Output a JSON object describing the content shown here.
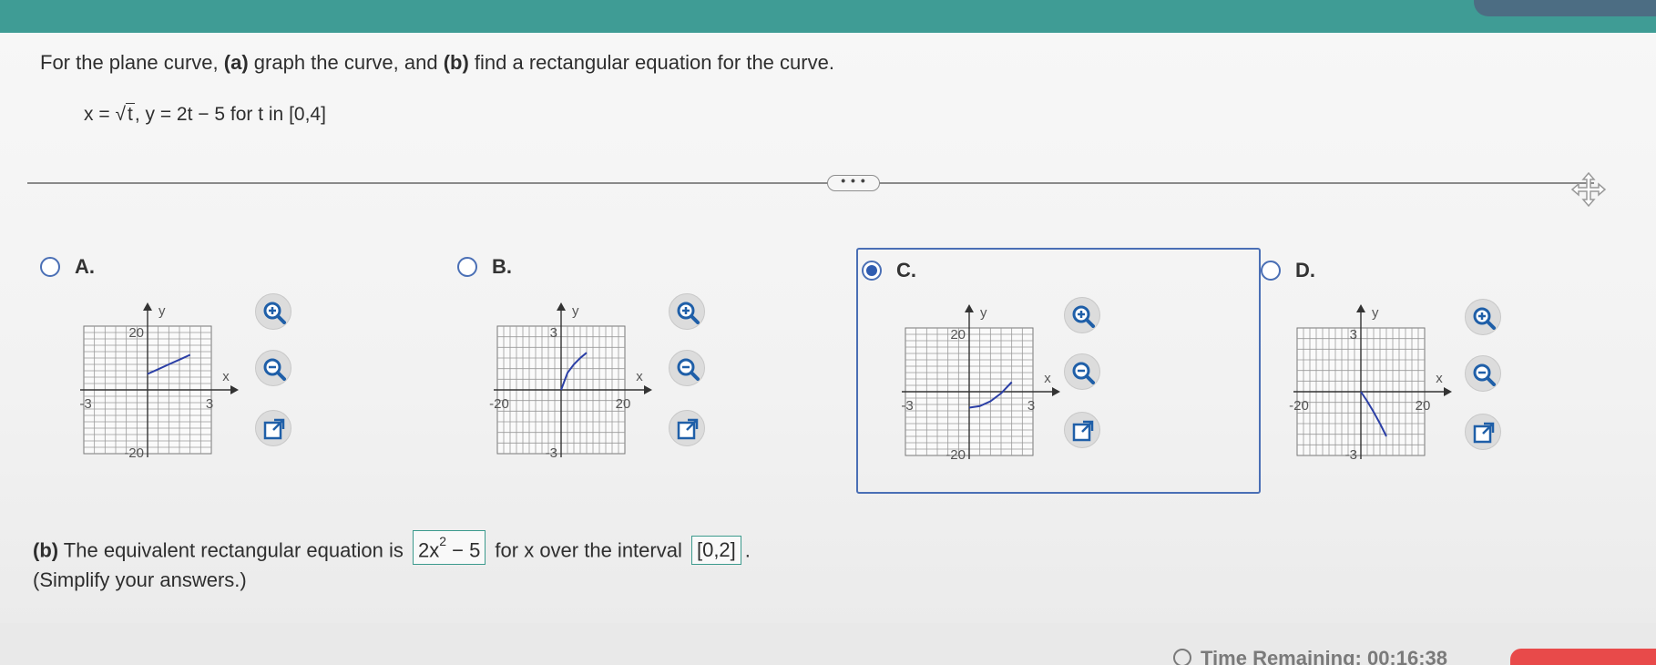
{
  "question": {
    "prompt_pre": "For the plane curve, ",
    "part_a_tag": "(a)",
    "prompt_mid1": " graph the curve, and ",
    "part_b_tag": "(b)",
    "prompt_mid2": " find a rectangular equation for the curve.",
    "eq_x_prefix": "x = ",
    "eq_radicand": "t",
    "eq_rest": ", y = 2t − 5 for t in [0,4]"
  },
  "more_button_label": "• • •",
  "options": [
    {
      "id": "A",
      "label": "A.",
      "selected": false,
      "graph": {
        "y_top": "20",
        "y_bottom": "-20",
        "x_left": "-3",
        "x_right": "3",
        "x_axis_label": "x",
        "y_axis_label": "y",
        "xlim": [
          -3,
          3
        ],
        "ylim": [
          -20,
          20
        ],
        "curve": [
          [
            0,
            5
          ],
          [
            0.5,
            6.5
          ],
          [
            1,
            8
          ],
          [
            1.5,
            9.5
          ],
          [
            2,
            11
          ]
        ]
      }
    },
    {
      "id": "B",
      "label": "B.",
      "selected": false,
      "graph": {
        "y_top": "3",
        "y_bottom": "-3",
        "x_left": "-20",
        "x_right": "20",
        "x_axis_label": "x",
        "y_axis_label": "y",
        "xlim": [
          -20,
          20
        ],
        "ylim": [
          -3,
          3
        ],
        "curve": [
          [
            0,
            0
          ],
          [
            2,
            0.8
          ],
          [
            4,
            1.2
          ],
          [
            6,
            1.5
          ],
          [
            8,
            1.75
          ]
        ]
      }
    },
    {
      "id": "C",
      "label": "C.",
      "selected": true,
      "graph": {
        "y_top": "20",
        "y_bottom": "-20",
        "x_left": "-3",
        "x_right": "3",
        "x_axis_label": "x",
        "y_axis_label": "y",
        "xlim": [
          -3,
          3
        ],
        "ylim": [
          -20,
          20
        ],
        "curve": [
          [
            0,
            -5
          ],
          [
            0.5,
            -4.5
          ],
          [
            1,
            -3
          ],
          [
            1.5,
            -0.5
          ],
          [
            2,
            3
          ]
        ]
      }
    },
    {
      "id": "D",
      "label": "D.",
      "selected": false,
      "graph": {
        "y_top": "3",
        "y_bottom": "-3",
        "x_left": "-20",
        "x_right": "20",
        "x_axis_label": "x",
        "y_axis_label": "y",
        "xlim": [
          -20,
          20
        ],
        "ylim": [
          -3,
          3
        ],
        "curve": [
          [
            0,
            0
          ],
          [
            2,
            -0.45
          ],
          [
            4,
            -0.95
          ],
          [
            6,
            -1.5
          ],
          [
            8,
            -2.1
          ]
        ]
      }
    }
  ],
  "tools": {
    "zoom_in": "zoom-in",
    "zoom_out": "zoom-out",
    "popout": "open-in-new-window"
  },
  "part_b": {
    "tag": "(b)",
    "text_before": " The equivalent rectangular equation is ",
    "answer_base": "2x",
    "answer_exp": "2",
    "answer_tail": " − 5",
    "text_middle": " for x over the interval ",
    "interval": "[0,2]",
    "text_after": "."
  },
  "simplify_note": "(Simplify your answers.)",
  "timer_text": "Time Remaining: 00:16:38",
  "colors": {
    "accent": "#4a6fb5",
    "curve": "#2b3fa6",
    "teal_bar": "#3f9c95",
    "answer_border": "#3c9a8d"
  }
}
